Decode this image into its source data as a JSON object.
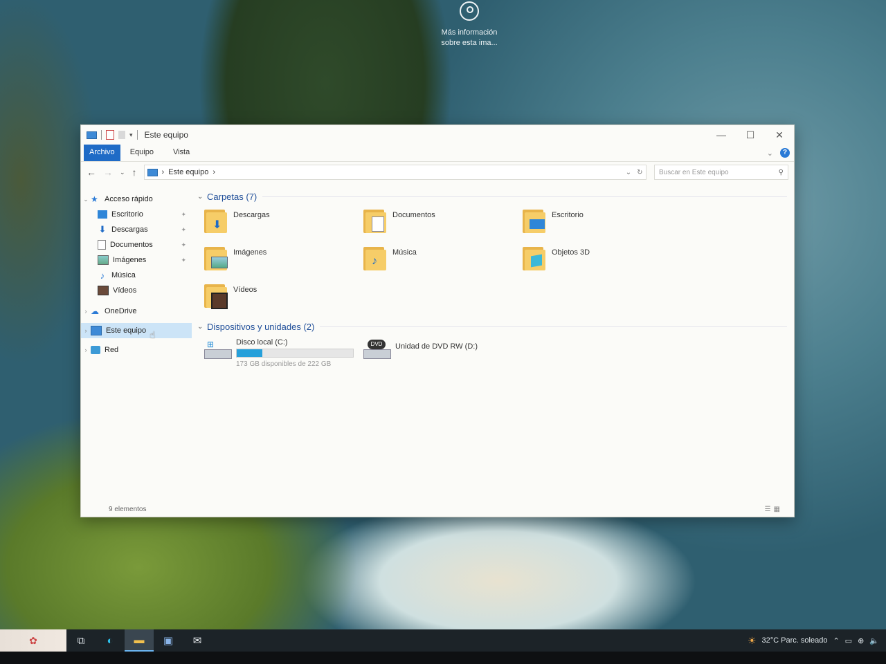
{
  "lockscreen": {
    "info_line1": "Más información",
    "info_line2": "sobre esta ima..."
  },
  "window": {
    "title": "Este equipo",
    "controls": {
      "minimize": "—",
      "maximize": "☐",
      "close": "✕"
    },
    "ribbon_tabs": [
      "Archivo",
      "Equipo",
      "Vista"
    ],
    "help_label": "?",
    "address": {
      "crumb": "Este equipo",
      "sep": "›"
    },
    "search_placeholder": "Buscar en Este equipo",
    "colors": {
      "accent": "#1f6bc6",
      "selected": "#cce4f7",
      "progress": "#26a0da"
    }
  },
  "sidebar": {
    "quick_access": "Acceso rápido",
    "quick_items": [
      {
        "label": "Escritorio",
        "icon": "desktop-icon",
        "pinned": true
      },
      {
        "label": "Descargas",
        "icon": "download-icon",
        "pinned": true
      },
      {
        "label": "Documentos",
        "icon": "document-icon",
        "pinned": true
      },
      {
        "label": "Imágenes",
        "icon": "pictures-icon",
        "pinned": true
      },
      {
        "label": "Música",
        "icon": "music-icon",
        "pinned": false
      },
      {
        "label": "Vídeos",
        "icon": "video-icon",
        "pinned": false
      }
    ],
    "onedrive": "OneDrive",
    "this_pc": "Este equipo",
    "network": "Red"
  },
  "content": {
    "folders_header": "Carpetas (7)",
    "folders": [
      {
        "label": "Descargas",
        "icon": "downloads-folder-icon"
      },
      {
        "label": "Documentos",
        "icon": "documents-folder-icon"
      },
      {
        "label": "Escritorio",
        "icon": "desktop-folder-icon"
      },
      {
        "label": "Imágenes",
        "icon": "pictures-folder-icon"
      },
      {
        "label": "Música",
        "icon": "music-folder-icon"
      },
      {
        "label": "Objetos 3D",
        "icon": "3d-objects-folder-icon"
      },
      {
        "label": "Vídeos",
        "icon": "videos-folder-icon"
      }
    ],
    "devices_header": "Dispositivos y unidades (2)",
    "drives": [
      {
        "label": "Disco local (C:)",
        "free_text": "173 GB disponibles de 222 GB",
        "used_fraction": 0.22
      },
      {
        "label": "Unidad de DVD RW (D:)"
      }
    ]
  },
  "status": {
    "count": "9 elementos"
  },
  "taskbar": {
    "weather": "32°C  Parc. soleado",
    "dvd_badge": "DVD"
  }
}
